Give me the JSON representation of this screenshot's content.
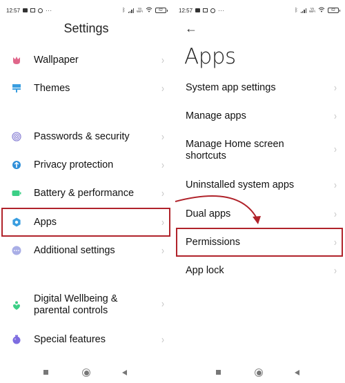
{
  "status_bar": {
    "time": "12:57",
    "more": "···",
    "vowifi_top": "Vo",
    "vowifi_bottom": "WiFi",
    "battery": "62"
  },
  "left": {
    "title": "Settings",
    "items": [
      {
        "label": "Wallpaper",
        "icon": "wallpaper-icon",
        "color": "#e0668a"
      },
      {
        "label": "Themes",
        "icon": "themes-icon",
        "color": "#3a9ee0"
      },
      {
        "label": "Passwords & security",
        "icon": "fingerprint-icon",
        "color": "#8e86d6"
      },
      {
        "label": "Privacy protection",
        "icon": "privacy-icon",
        "color": "#2f8fd8"
      },
      {
        "label": "Battery & performance",
        "icon": "battery-icon",
        "color": "#3ccf86"
      },
      {
        "label": "Apps",
        "icon": "gear-icon",
        "color": "#3a9ee0"
      },
      {
        "label": "Additional settings",
        "icon": "more-icon",
        "color": "#a9aee6"
      },
      {
        "label": "Digital Wellbeing & parental controls",
        "icon": "wellbeing-icon",
        "color": "#3ccf86"
      },
      {
        "label": "Special features",
        "icon": "special-features-icon",
        "color": "#7d6ce0"
      }
    ]
  },
  "right": {
    "back_label": "←",
    "title": "Apps",
    "items": [
      {
        "label": "System app settings"
      },
      {
        "label": "Manage apps"
      },
      {
        "label": "Manage Home screen shortcuts"
      },
      {
        "label": "Uninstalled system apps"
      },
      {
        "label": "Dual apps"
      },
      {
        "label": "Permissions"
      },
      {
        "label": "App lock"
      }
    ]
  },
  "chevron": "›",
  "annotation": {
    "color": "#b0222a"
  }
}
